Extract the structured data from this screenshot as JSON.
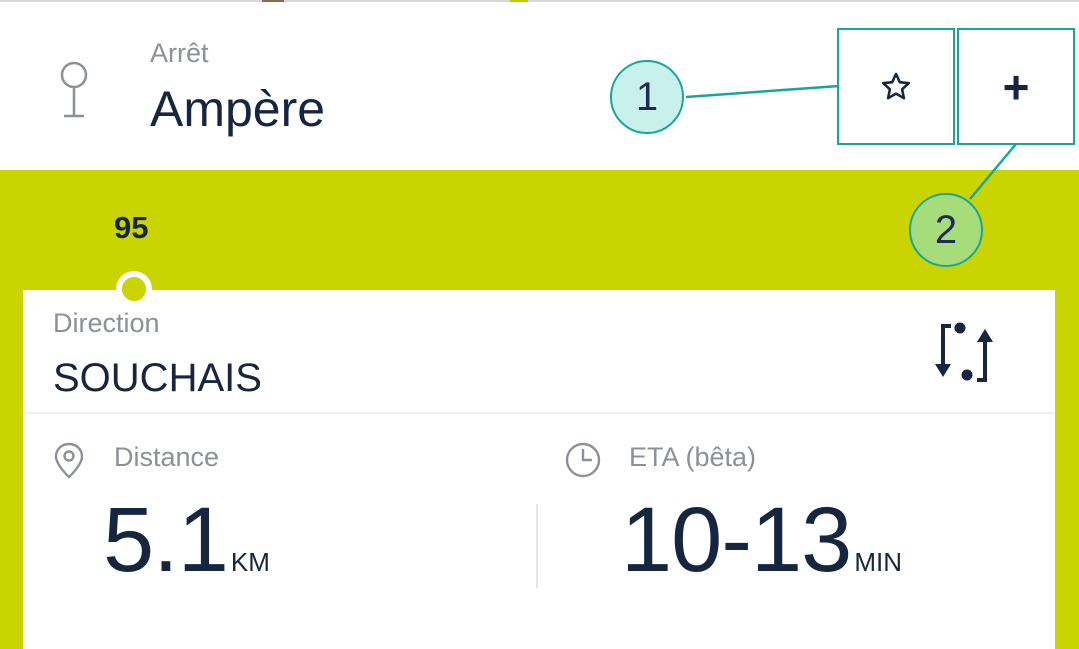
{
  "header": {
    "stop_label": "Arrêt",
    "stop_name": "Ampère",
    "favorite_icon": "star-outline-icon",
    "add_label": "+"
  },
  "callouts": [
    "1",
    "2"
  ],
  "line": {
    "route_number": "95",
    "color": "#c9d400"
  },
  "direction": {
    "label": "Direction",
    "name": "SOUCHAIS",
    "swap_icon": "swap-direction-icon"
  },
  "metrics": {
    "distance": {
      "icon": "location-pin-icon",
      "label": "Distance",
      "value": "5.1",
      "unit": "KM"
    },
    "eta": {
      "icon": "clock-icon",
      "label": "ETA (bêta)",
      "value": "10-13",
      "unit": "MIN"
    }
  },
  "colors": {
    "accent_teal": "#17a699",
    "text_dark": "#16263f",
    "text_muted": "#8c9098",
    "callout_1_fill": "#c8f1ec",
    "callout_2_fill": "#a6dc7a"
  }
}
